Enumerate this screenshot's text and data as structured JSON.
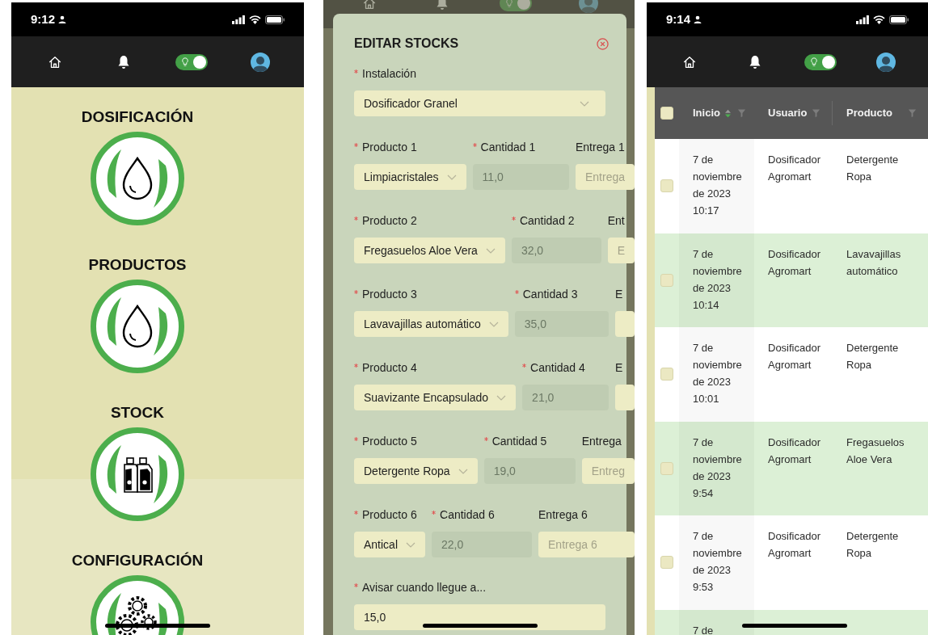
{
  "screens": [
    {
      "kind": "menu",
      "status_bar": {
        "time": "9:12"
      },
      "nav": {
        "toggle_on": true
      },
      "sections": [
        {
          "title": "DOSIFICACIÓN",
          "kind": "drop"
        },
        {
          "title": "PRODUCTOS",
          "kind": "drop"
        },
        {
          "title": "STOCK",
          "kind": "bottles"
        },
        {
          "title": "CONFIGURACIÓN",
          "kind": "gears"
        }
      ]
    },
    {
      "kind": "form",
      "nav": {
        "toggle_on": true
      },
      "dialog": {
        "title": "EDITAR STOCKS",
        "installation": {
          "label": "Instalación",
          "required": true,
          "value": "Dosificador Granel"
        },
        "products": [
          {
            "fields": [
              {
                "kind": "select",
                "label": "Producto 1",
                "required": true,
                "value": "Limpiacristales"
              },
              {
                "kind": "input",
                "label": "Cantidad 1",
                "required": true,
                "value": "11,0",
                "disabled": true
              },
              {
                "kind": "input",
                "label": "Entrega 1",
                "placeholder": "Entrega",
                "disabled": false
              }
            ]
          },
          {
            "fields": [
              {
                "kind": "select",
                "label": "Producto 2",
                "required": true,
                "value": "Fregasuelos Aloe Vera"
              },
              {
                "kind": "input",
                "label": "Cantidad 2",
                "required": true,
                "value": "32,0",
                "disabled": true
              },
              {
                "kind": "input",
                "label": "Ent",
                "placeholder": "E",
                "disabled": false
              }
            ]
          },
          {
            "fields": [
              {
                "kind": "select",
                "label": "Producto 3",
                "required": true,
                "value": "Lavavajillas automático"
              },
              {
                "kind": "input",
                "label": "Cantidad 3",
                "required": true,
                "value": "35,0",
                "disabled": true
              },
              {
                "kind": "input",
                "label": "E",
                "disabled": false
              }
            ]
          },
          {
            "fields": [
              {
                "kind": "select",
                "label": "Producto 4",
                "required": true,
                "value": "Suavizante Encapsulado"
              },
              {
                "kind": "input",
                "label": "Cantidad 4",
                "required": true,
                "value": "21,0",
                "disabled": true
              },
              {
                "kind": "input",
                "label": "E",
                "disabled": false
              }
            ]
          },
          {
            "fields": [
              {
                "kind": "select",
                "label": "Producto 5",
                "required": true,
                "value": "Detergente Ropa"
              },
              {
                "kind": "input",
                "label": "Cantidad 5",
                "required": true,
                "value": "19,0",
                "disabled": true
              },
              {
                "kind": "input",
                "label": "Entrega",
                "placeholder": "Entreg",
                "disabled": false
              }
            ]
          },
          {
            "fields": [
              {
                "kind": "select",
                "label": "Producto 6",
                "required": true,
                "value": "Antical"
              },
              {
                "kind": "input",
                "label": "Cantidad 6",
                "required": true,
                "value": "22,0",
                "disabled": true
              },
              {
                "kind": "input",
                "label": "Entrega 6",
                "placeholder": "Entrega 6",
                "disabled": false
              }
            ]
          }
        ],
        "alert": {
          "label": "Avisar cuando llegue a...",
          "required": true,
          "value": "15,0"
        }
      }
    },
    {
      "kind": "table",
      "status_bar": {
        "time": "9:14"
      },
      "nav": {
        "toggle_on": true
      },
      "table": {
        "header_checked": false,
        "columns": [
          {
            "label": "Inicio",
            "sort_descending": true,
            "filterable": true
          },
          {
            "label": "Usuario",
            "filterable": true
          },
          {
            "label": "Producto",
            "filterable": true
          }
        ],
        "rows": [
          {
            "checked": false,
            "start": "7 de noviembre de 2023 10:17",
            "user": "Dosificador Agromart",
            "product": "Detergente Ropa"
          },
          {
            "checked": false,
            "start": "7 de noviembre de 2023 10:14",
            "user": "Dosificador Agromart",
            "product": "Lavavajillas automático"
          },
          {
            "checked": false,
            "start": "7 de noviembre de 2023 10:01",
            "user": "Dosificador Agromart",
            "product": "Detergente Ropa"
          },
          {
            "checked": false,
            "start": "7 de noviembre de 2023 9:54",
            "user": "Dosificador Agromart",
            "product": "Fregasuelos Aloe Vera"
          },
          {
            "checked": false,
            "start": "7 de noviembre de 2023 9:53",
            "user": "Dosificador Agromart",
            "product": "Detergente Ropa"
          },
          {
            "start": "7 de"
          }
        ]
      }
    }
  ]
}
